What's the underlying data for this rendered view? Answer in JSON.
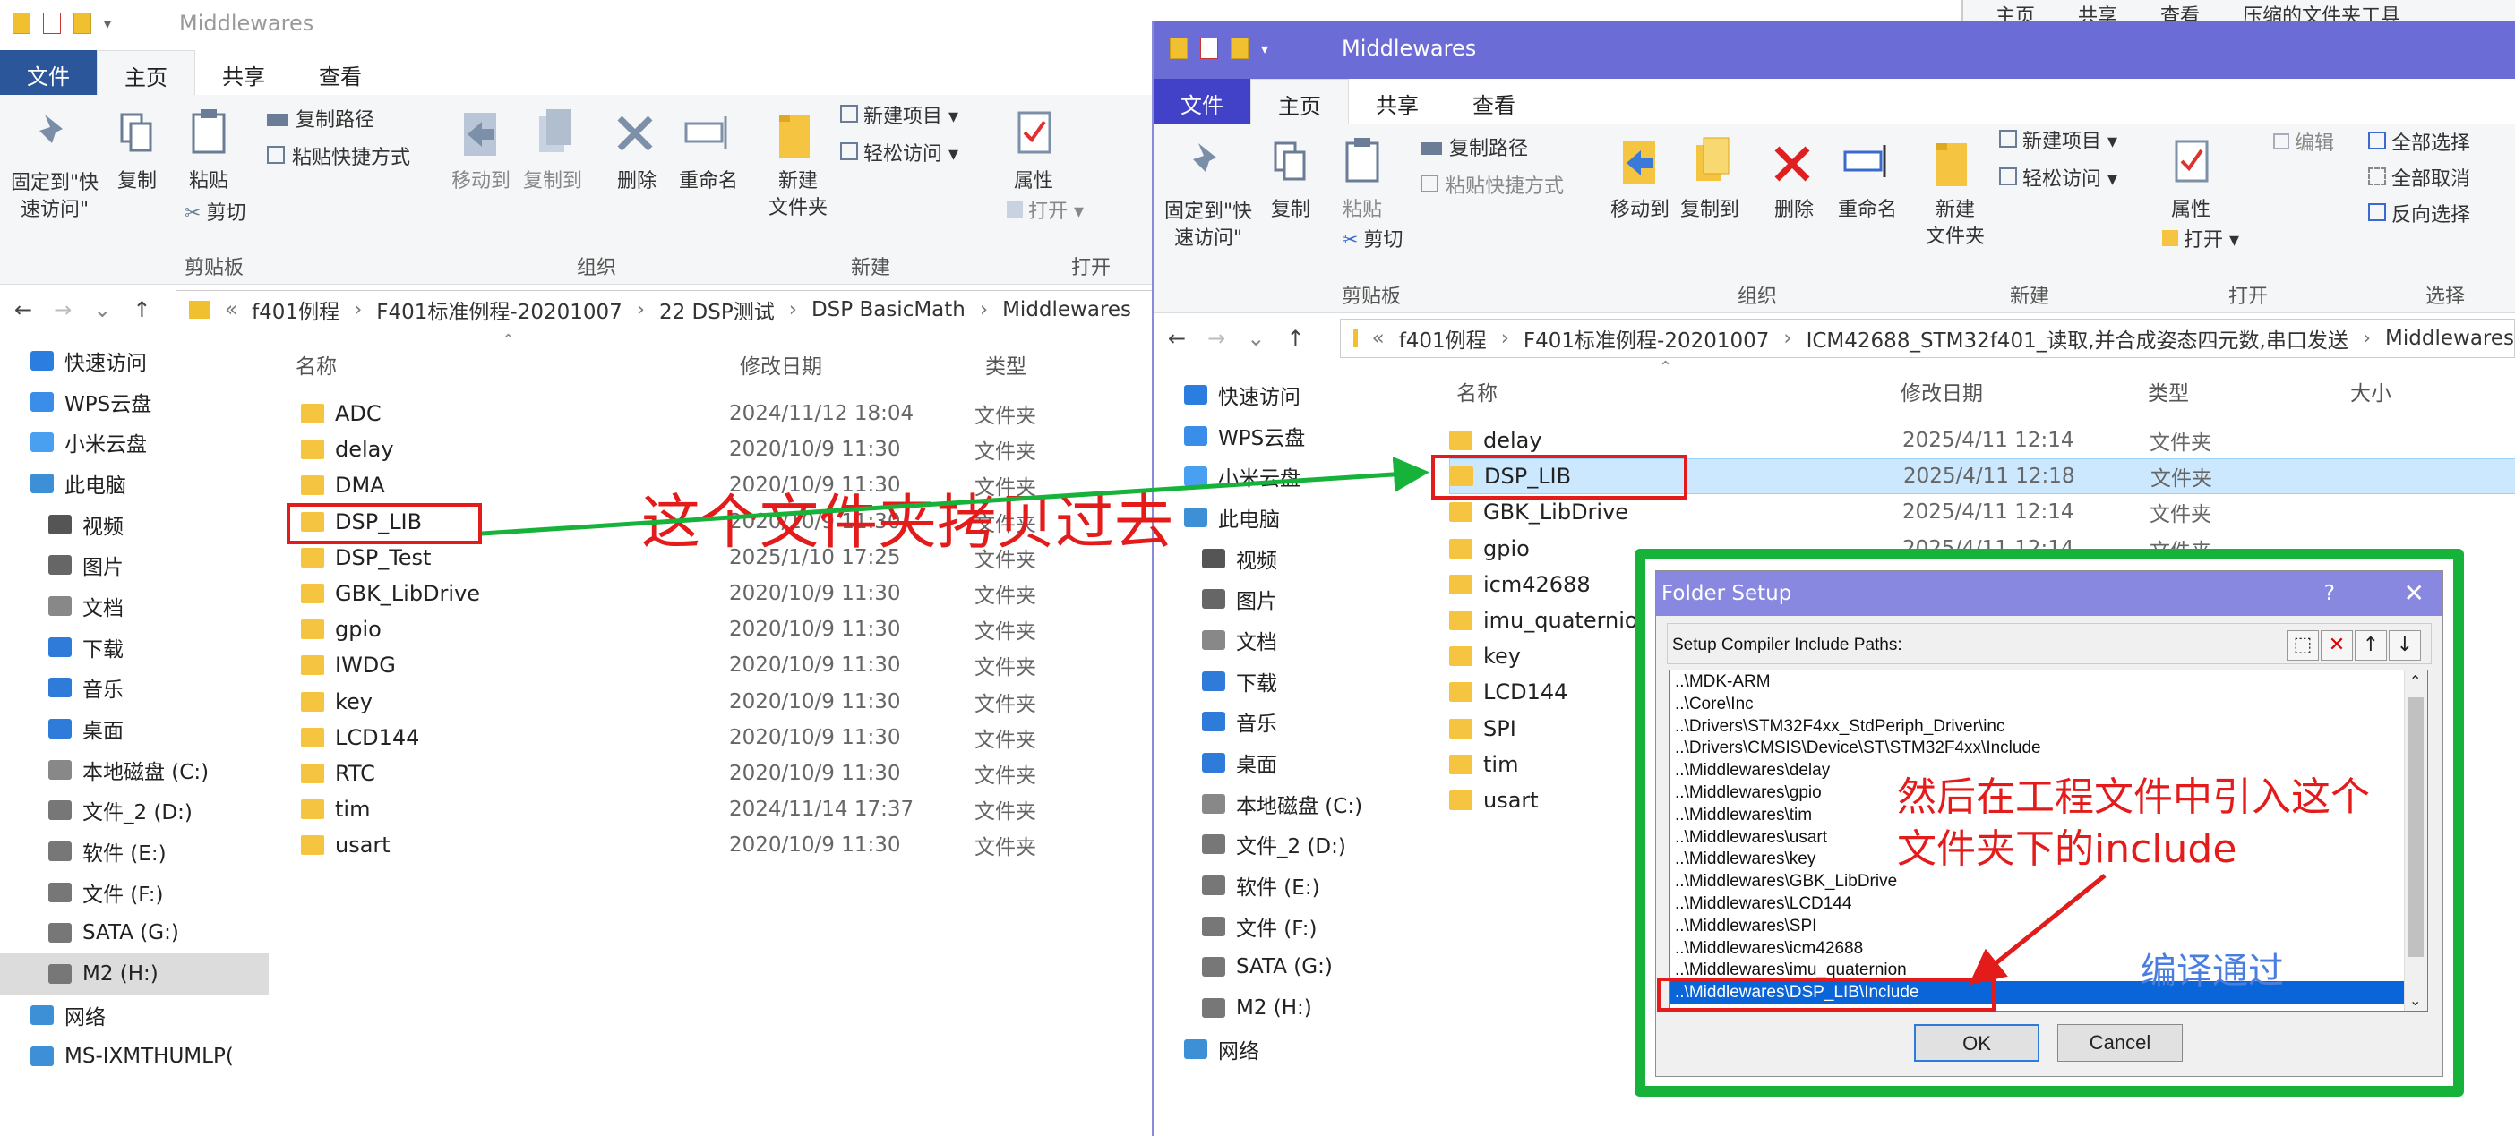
{
  "left_window": {
    "title": "Middlewares",
    "ribbon_tabs": [
      "文件",
      "主页",
      "共享",
      "查看"
    ],
    "ribbon": {
      "pin": "固定到\"快\n速访问\"",
      "copy": "复制",
      "paste": "粘贴",
      "copy_path": "复制路径",
      "paste_shortcut": "粘贴快捷方式",
      "cut": "剪切",
      "move_to": "移动到",
      "copy_to": "复制到",
      "delete": "删除",
      "rename": "重命名",
      "new_folder": "新建\n文件夹",
      "new_item": "新建项目",
      "easy_access": "轻松访问",
      "properties": "属性",
      "open": "打开",
      "group_clipboard": "剪贴板",
      "group_organize": "组织",
      "group_new": "新建",
      "group_open": "打开"
    },
    "path": [
      "f401例程",
      "F401标准例程-20201007",
      "22 DSP测试",
      "DSP BasicMath",
      "Middlewares"
    ],
    "columns": {
      "name": "名称",
      "date": "修改日期",
      "type": "类型"
    },
    "nav": [
      {
        "label": "快速访问",
        "icon": "star-icon",
        "color": "#2b7de0"
      },
      {
        "label": "WPS云盘",
        "icon": "cloud-icon",
        "color": "#3a8de8"
      },
      {
        "label": "小米云盘",
        "icon": "cloud-icon",
        "color": "#4aa0f0"
      },
      {
        "label": "此电脑",
        "icon": "computer-icon",
        "color": "#3d8fd6"
      },
      {
        "label": "视频",
        "icon": "video-icon",
        "color": "#555"
      },
      {
        "label": "图片",
        "icon": "picture-icon",
        "color": "#666"
      },
      {
        "label": "文档",
        "icon": "document-icon",
        "color": "#888"
      },
      {
        "label": "下载",
        "icon": "download-icon",
        "color": "#2f7bd9"
      },
      {
        "label": "音乐",
        "icon": "music-icon",
        "color": "#2f7bd9"
      },
      {
        "label": "桌面",
        "icon": "desktop-icon",
        "color": "#2f7bd9"
      },
      {
        "label": "本地磁盘 (C:)",
        "icon": "drive-icon",
        "color": "#888"
      },
      {
        "label": "文件_2 (D:)",
        "icon": "drive-icon",
        "color": "#777"
      },
      {
        "label": "软件 (E:)",
        "icon": "drive-icon",
        "color": "#777"
      },
      {
        "label": "文件 (F:)",
        "icon": "drive-icon",
        "color": "#777"
      },
      {
        "label": "SATA (G:)",
        "icon": "drive-icon",
        "color": "#777"
      },
      {
        "label": "M2 (H:)",
        "icon": "drive-icon",
        "color": "#777"
      },
      {
        "label": "网络",
        "icon": "network-icon",
        "color": "#3d8fd6"
      },
      {
        "label": "MS-IXMTHUMLP(",
        "icon": "computer-icon",
        "color": "#3d8fd6"
      }
    ],
    "files": [
      {
        "name": "ADC",
        "date": "2024/11/12 18:04",
        "type": "文件夹"
      },
      {
        "name": "delay",
        "date": "2020/10/9 11:30",
        "type": "文件夹"
      },
      {
        "name": "DMA",
        "date": "2020/10/9 11:30",
        "type": "文件夹"
      },
      {
        "name": "DSP_LIB",
        "date": "2020/10/9 11:30",
        "type": "文件夹"
      },
      {
        "name": "DSP_Test",
        "date": "2025/1/10 17:25",
        "type": "文件夹"
      },
      {
        "name": "GBK_LibDrive",
        "date": "2020/10/9 11:30",
        "type": "文件夹"
      },
      {
        "name": "gpio",
        "date": "2020/10/9 11:30",
        "type": "文件夹"
      },
      {
        "name": "IWDG",
        "date": "2020/10/9 11:30",
        "type": "文件夹"
      },
      {
        "name": "key",
        "date": "2020/10/9 11:30",
        "type": "文件夹"
      },
      {
        "name": "LCD144",
        "date": "2020/10/9 11:30",
        "type": "文件夹"
      },
      {
        "name": "RTC",
        "date": "2020/10/9 11:30",
        "type": "文件夹"
      },
      {
        "name": "tim",
        "date": "2024/11/14 17:37",
        "type": "文件夹"
      },
      {
        "name": "usart",
        "date": "2020/10/9 11:30",
        "type": "文件夹"
      }
    ]
  },
  "right_window": {
    "title": "Middlewares",
    "ribbon_tabs": [
      "文件",
      "主页",
      "共享",
      "查看"
    ],
    "ribbon": {
      "pin": "固定到\"快\n速访问\"",
      "copy": "复制",
      "paste": "粘贴",
      "copy_path": "复制路径",
      "paste_shortcut": "粘贴快捷方式",
      "cut": "剪切",
      "move_to": "移动到",
      "copy_to": "复制到",
      "delete": "删除",
      "rename": "重命名",
      "new_folder": "新建\n文件夹",
      "new_item": "新建项目",
      "easy_access": "轻松访问",
      "properties": "属性",
      "edit": "编辑",
      "open": "打开",
      "select_all": "全部选择",
      "select_none": "全部取消",
      "invert": "反向选择",
      "group_clipboard": "剪贴板",
      "group_organize": "组织",
      "group_new": "新建",
      "group_open": "打开",
      "group_select": "选择"
    },
    "path": [
      "f401例程",
      "F401标准例程-20201007",
      "ICM42688_STM32f401_读取,并合成姿态四元数,串口发送",
      "Middlewares"
    ],
    "columns": {
      "name": "名称",
      "date": "修改日期",
      "type": "类型",
      "size": "大小"
    },
    "nav": [
      {
        "label": "快速访问",
        "icon": "star-icon",
        "color": "#2b7de0"
      },
      {
        "label": "WPS云盘",
        "icon": "cloud-icon",
        "color": "#3a8de8"
      },
      {
        "label": "小米云盘",
        "icon": "cloud-icon",
        "color": "#4aa0f0"
      },
      {
        "label": "此电脑",
        "icon": "computer-icon",
        "color": "#3d8fd6"
      },
      {
        "label": "视频",
        "icon": "video-icon",
        "color": "#555"
      },
      {
        "label": "图片",
        "icon": "picture-icon",
        "color": "#666"
      },
      {
        "label": "文档",
        "icon": "document-icon",
        "color": "#888"
      },
      {
        "label": "下载",
        "icon": "download-icon",
        "color": "#2f7bd9"
      },
      {
        "label": "音乐",
        "icon": "music-icon",
        "color": "#2f7bd9"
      },
      {
        "label": "桌面",
        "icon": "desktop-icon",
        "color": "#2f7bd9"
      },
      {
        "label": "本地磁盘 (C:)",
        "icon": "drive-icon",
        "color": "#888"
      },
      {
        "label": "文件_2 (D:)",
        "icon": "drive-icon",
        "color": "#777"
      },
      {
        "label": "软件 (E:)",
        "icon": "drive-icon",
        "color": "#777"
      },
      {
        "label": "文件 (F:)",
        "icon": "drive-icon",
        "color": "#777"
      },
      {
        "label": "SATA (G:)",
        "icon": "drive-icon",
        "color": "#777"
      },
      {
        "label": "M2 (H:)",
        "icon": "drive-icon",
        "color": "#777"
      },
      {
        "label": "网络",
        "icon": "network-icon",
        "color": "#3d8fd6"
      }
    ],
    "files": [
      {
        "name": "delay",
        "date": "2025/4/11 12:14",
        "type": "文件夹"
      },
      {
        "name": "DSP_LIB",
        "date": "2025/4/11 12:18",
        "type": "文件夹"
      },
      {
        "name": "GBK_LibDrive",
        "date": "2025/4/11 12:14",
        "type": "文件夹"
      },
      {
        "name": "gpio",
        "date": "2025/4/11 12:14",
        "type": "文件夹"
      },
      {
        "name": "icm42688",
        "date": "",
        "type": ""
      },
      {
        "name": "imu_quaternion",
        "date": "",
        "type": ""
      },
      {
        "name": "key",
        "date": "",
        "type": ""
      },
      {
        "name": "LCD144",
        "date": "",
        "type": ""
      },
      {
        "name": "SPI",
        "date": "",
        "type": ""
      },
      {
        "name": "tim",
        "date": "",
        "type": ""
      },
      {
        "name": "usart",
        "date": "",
        "type": ""
      }
    ]
  },
  "dialog": {
    "title": "Folder Setup",
    "help": "?",
    "close": "✕",
    "label": "Setup Compiler Include Paths:",
    "paths": [
      "..\\MDK-ARM",
      "..\\Core\\Inc",
      "..\\Drivers\\STM32F4xx_StdPeriph_Driver\\inc",
      "..\\Drivers\\CMSIS\\Device\\ST\\STM32F4xx\\Include",
      "..\\Middlewares\\delay",
      "..\\Middlewares\\gpio",
      "..\\Middlewares\\tim",
      "..\\Middlewares\\usart",
      "..\\Middlewares\\key",
      "..\\Middlewares\\GBK_LibDrive",
      "..\\Middlewares\\LCD144",
      "..\\Middlewares\\SPI",
      "..\\Middlewares\\icm42688",
      "..\\Middlewares\\imu_quaternion",
      "..\\Middlewares\\DSP_LIB\\Include"
    ],
    "selected_index": 14,
    "ok": "OK",
    "cancel": "Cancel"
  },
  "annotations": {
    "copy_note": "这个文件夹拷贝过去",
    "include_note_1": "然后在工程文件中引入这个",
    "include_note_2": "文件夹下的include",
    "compile_note": "编译通过",
    "red": "#e31b1b",
    "green": "#16b23a",
    "blue_note": "#4a7de0"
  },
  "background_window": {
    "tabs": [
      "主页",
      "共享",
      "查看",
      "压缩的文件夹工具"
    ]
  }
}
